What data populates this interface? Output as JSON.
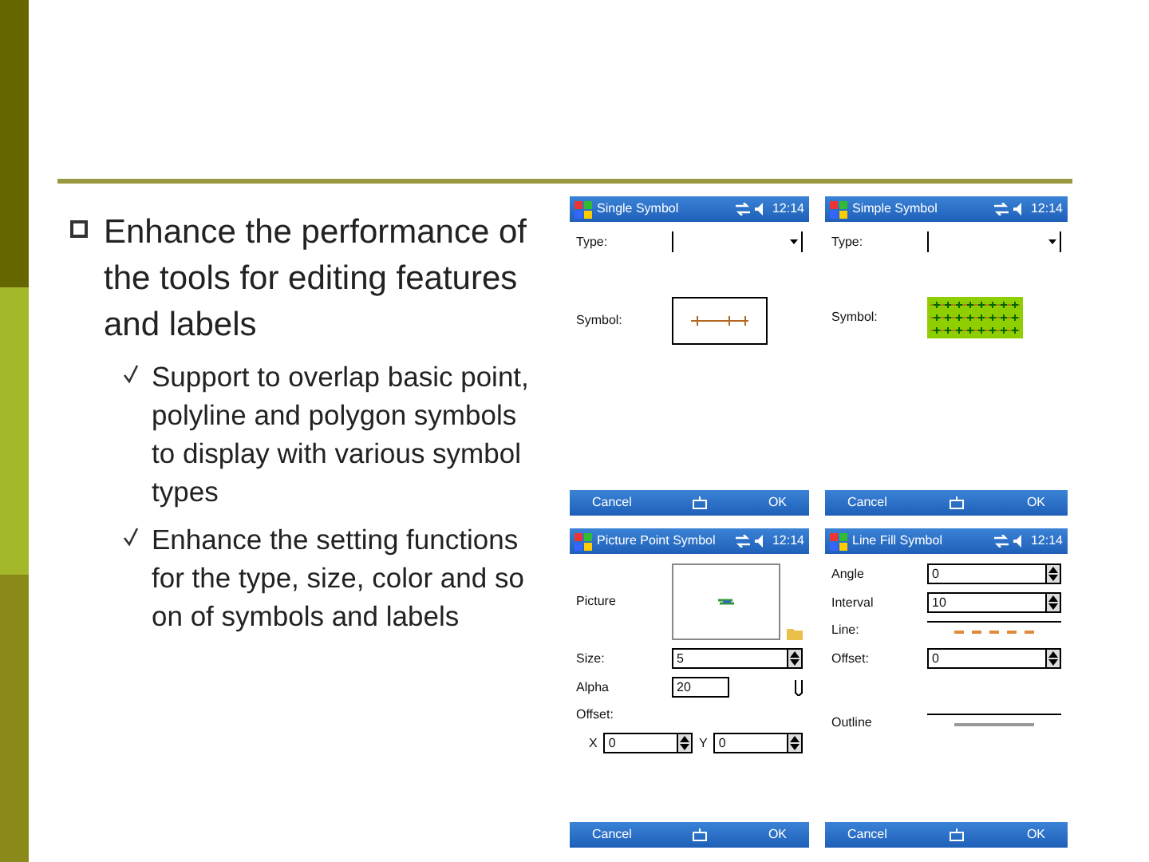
{
  "bullets": [
    {
      "text": "Enhance the performance of the tools for editing features and labels",
      "children": [
        {
          "text": "Support to overlap basic point, polyline and polygon symbols to display with various symbol types"
        },
        {
          "text": "Enhance the setting functions for the type, size, color and so on of symbols and labels"
        }
      ]
    }
  ],
  "phones": [
    {
      "title": "Single Symbol",
      "time": "12:14",
      "rows": [
        {
          "kind": "dropdown",
          "label": "Type:"
        },
        {
          "kind": "gap"
        },
        {
          "kind": "line-symbol",
          "label": "Symbol:"
        }
      ],
      "left_button": "Cancel",
      "right_button": "OK"
    },
    {
      "title": "Simple Symbol",
      "time": "12:14",
      "rows": [
        {
          "kind": "dropdown",
          "label": "Type:"
        },
        {
          "kind": "gap"
        },
        {
          "kind": "fill-symbol",
          "label": "Symbol:"
        }
      ],
      "left_button": "Cancel",
      "right_button": "OK"
    },
    {
      "title": "Picture Point Symbol",
      "time": "12:14",
      "rows": [
        {
          "kind": "picture",
          "label": "Picture"
        },
        {
          "kind": "spinner",
          "label": "Size:",
          "value": "5"
        },
        {
          "kind": "slider",
          "label": "Alpha",
          "value": "20"
        },
        {
          "kind": "label",
          "label": "Offset:"
        },
        {
          "kind": "xy",
          "label": "X",
          "value": "0",
          "label2": "Y",
          "value2": "0"
        }
      ],
      "left_button": "Cancel",
      "right_button": "OK"
    },
    {
      "title": "Line Fill Symbol",
      "time": "12:14",
      "rows": [
        {
          "kind": "spinner",
          "label": "Angle",
          "value": "0"
        },
        {
          "kind": "spinner",
          "label": "Interval",
          "value": "10"
        },
        {
          "kind": "line-preview",
          "label": "Line:",
          "color": "#e08a3c"
        },
        {
          "kind": "spinner",
          "label": "Offset:",
          "value": "0"
        },
        {
          "kind": "gap"
        },
        {
          "kind": "line-preview",
          "label": "Outline",
          "color": "#999999"
        }
      ],
      "left_button": "Cancel",
      "right_button": "OK"
    }
  ]
}
